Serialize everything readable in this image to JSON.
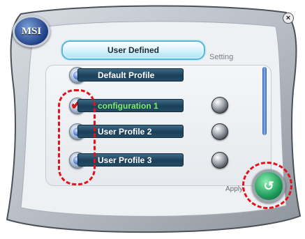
{
  "app": {
    "logo_text": "MSI",
    "close_glyph": "×"
  },
  "mode": {
    "value": "User Defined"
  },
  "labels": {
    "setting": "Setting",
    "apply": "Apply"
  },
  "profiles": [
    {
      "label": "Default Profile",
      "checked": false,
      "has_knob": false
    },
    {
      "label": "configuration 1",
      "checked": true,
      "has_knob": true
    },
    {
      "label": "User Profile 2",
      "checked": false,
      "has_knob": true
    },
    {
      "label": "User Profile 3",
      "checked": false,
      "has_knob": true
    }
  ],
  "icons": {
    "check": "✔",
    "apply": "↺"
  },
  "colors": {
    "highlight": "#e3121b",
    "active_text": "#7df06a",
    "accent": "#58b8dc"
  }
}
